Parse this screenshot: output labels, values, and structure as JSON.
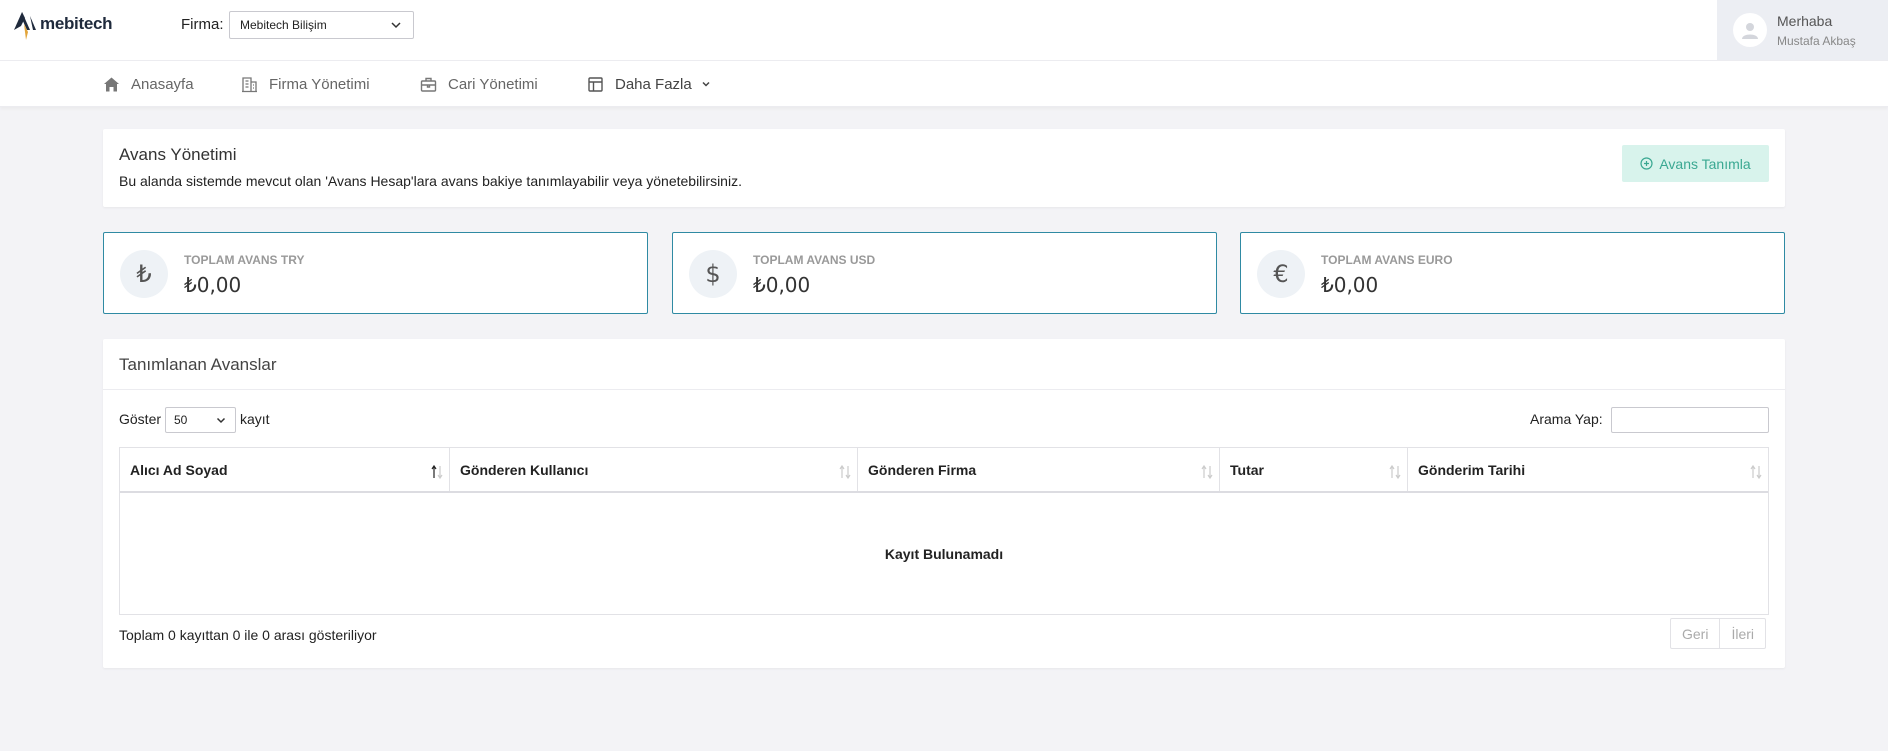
{
  "app": {
    "logo_text": "mebitech"
  },
  "topbar": {
    "firma_label": "Firma:",
    "firma_value": "Mebitech Bilişim",
    "user_greeting": "Merhaba",
    "user_name": "Mustafa Akbaş"
  },
  "nav": [
    {
      "label": "Anasayfa",
      "icon": "home-icon"
    },
    {
      "label": "Firma Yönetimi",
      "icon": "building-icon"
    },
    {
      "label": "Cari Yönetimi",
      "icon": "briefcase-icon"
    },
    {
      "label": "Daha Fazla",
      "icon": "layout-icon"
    }
  ],
  "page": {
    "title": "Avans Yönetimi",
    "description": "Bu alanda sistemde mevcut olan 'Avans Hesap'lara avans bakiye tanımlayabilir veya yönetebilirsiniz.",
    "add_button": "Avans Tanımla"
  },
  "stats": [
    {
      "label": "TOPLAM AVANS TRY",
      "value": "₺0,00",
      "symbol": "₺"
    },
    {
      "label": "TOPLAM AVANS USD",
      "value": "₺0,00",
      "symbol": "$"
    },
    {
      "label": "TOPLAM AVANS EURO",
      "value": "₺0,00",
      "symbol": "€"
    }
  ],
  "table": {
    "title": "Tanımlanan Avanslar",
    "show_label": "Göster",
    "page_size": "50",
    "records_label": "kayıt",
    "search_label": "Arama Yap:",
    "search_value": "",
    "columns": [
      "Alıcı Ad Soyad",
      "Gönderen Kullanıcı",
      "Gönderen Firma",
      "Tutar",
      "Gönderim Tarihi"
    ],
    "empty_text": "Kayıt Bulunamadı",
    "info": "Toplam 0 kayıttan 0 ile 0 arası gösteriliyor",
    "prev": "Geri",
    "next": "İleri"
  },
  "colors": {
    "accent": "#2f8aa3",
    "button_bg": "#d8f3ec",
    "button_text": "#3aa892"
  }
}
